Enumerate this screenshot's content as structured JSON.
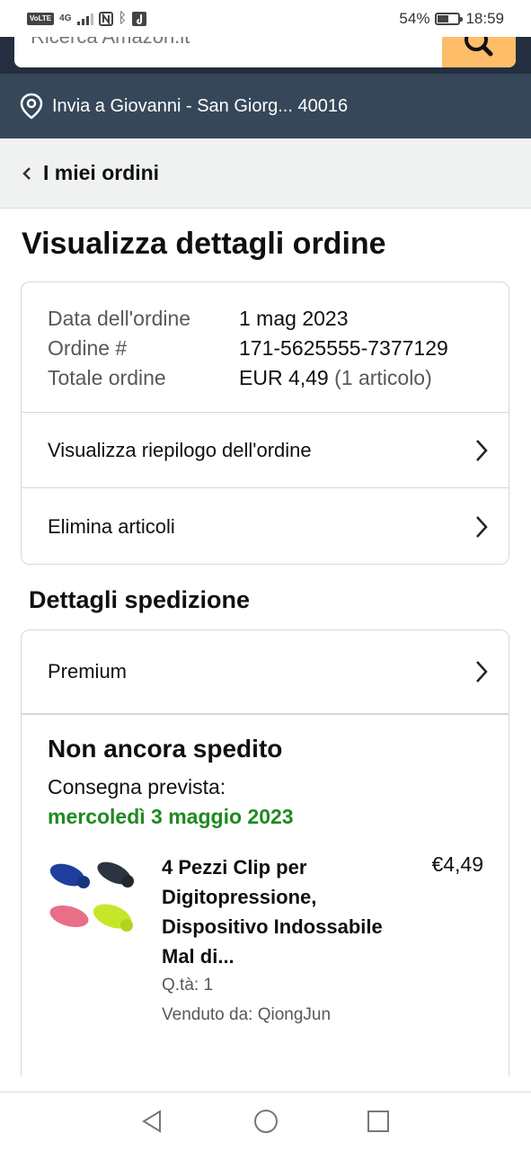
{
  "status_bar": {
    "network_badge": "VoLTE",
    "signal": "4G",
    "battery_percent_label": "54%",
    "battery_level": 0.54,
    "time": "18:59"
  },
  "search": {
    "placeholder": "Ricerca Amazon.it",
    "icon": "search-icon"
  },
  "location": {
    "icon": "location-pin-icon",
    "text": "Invia a Giovanni - San Giorg... 40016"
  },
  "breadcrumb": {
    "back_icon": "chevron-left-icon",
    "label": "I miei ordini"
  },
  "page_title": "Visualizza dettagli ordine",
  "order_summary": {
    "rows": [
      {
        "label": "Data dell'ordine",
        "value": "1 mag 2023"
      },
      {
        "label": "Ordine #",
        "value": "171-5625555-7377129"
      }
    ],
    "total_label": "Totale ordine",
    "total_value": "EUR 4,49",
    "total_count": "(1 articolo)",
    "links": [
      {
        "label": "Visualizza riepilogo dell'ordine",
        "icon": "chevron-right-icon"
      },
      {
        "label": "Elimina articoli",
        "icon": "chevron-right-icon"
      }
    ]
  },
  "shipping": {
    "section_title": "Dettagli spedizione",
    "method": "Premium",
    "method_icon": "chevron-right-icon",
    "status": "Non ancora spedito",
    "delivery_label": "Consegna prevista:",
    "delivery_date": "mercoledì 3 maggio 2023",
    "delivery_color": "#1f8a1f",
    "item": {
      "title": "4 Pezzi Clip per Digitopressione, Dispositivo Indossabile Mal di...",
      "price": "€4,49",
      "qty": "Q.tà: 1",
      "seller": "Venduto da: QiongJun",
      "image_colors": [
        "#1f3f9e",
        "#2c3440",
        "#e86f86",
        "#c6e62a"
      ]
    }
  },
  "nav_bar": {
    "back": "back-triangle-icon",
    "home": "home-circle-icon",
    "recents": "recents-square-icon"
  },
  "colors": {
    "header_dark": "#232f3e",
    "location_bar": "#37475a",
    "search_button": "#febd69",
    "breadcrumb_bg": "#f0f2f2"
  }
}
